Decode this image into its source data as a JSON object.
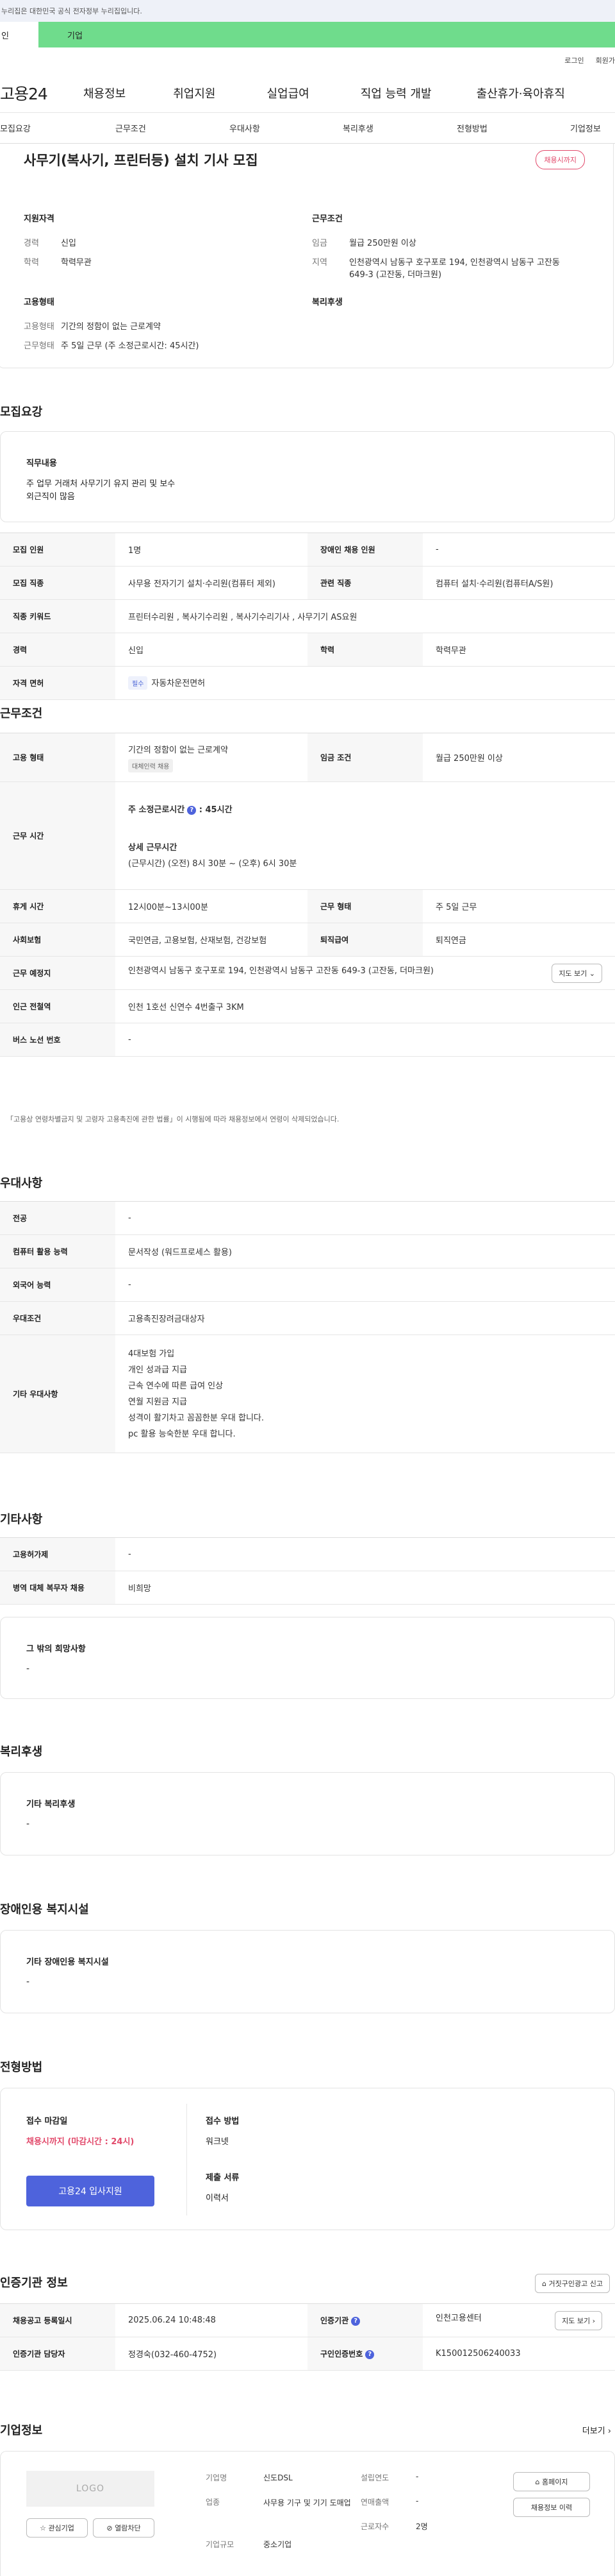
{
  "top_notice": "누리집은 대한민국 공식 전자정부 누리집입니다.",
  "tabs": {
    "left": "인",
    "right": "기업"
  },
  "util": {
    "login": "로그인",
    "join": "회원가"
  },
  "gnb": {
    "logo": "고용24",
    "items": [
      "채용정보",
      "취업지원",
      "실업급여",
      "직업 능력 개발",
      "출산휴가·육아휴직"
    ]
  },
  "subnav": [
    "모집요강",
    "근무조건",
    "우대사항",
    "복리후생",
    "전형방법",
    "기업정보"
  ],
  "title": {
    "text": "사무기(복사기, 프린터등) 설치 기사 모집",
    "status": "채용시까지"
  },
  "summary": {
    "qual_title": "지원자격",
    "cond_title": "근무조건",
    "emp_title": "고용형태",
    "welfare_title": "복리후생",
    "qual": [
      {
        "k": "경력",
        "v": "신입"
      },
      {
        "k": "학력",
        "v": "학력무관"
      }
    ],
    "cond": [
      {
        "k": "임금",
        "v": "월급 250만원 이상"
      },
      {
        "k": "지역",
        "v": "인천광역시 남동구 호구포로 194, 인천광역시 남동구 고잔동 649-3 (고잔동, 더마크원)"
      }
    ],
    "emp": [
      {
        "k": "고용형태",
        "v": "기간의 정함이 없는 근로계약"
      },
      {
        "k": "근무형태",
        "v": "주 5일 근무 (주 소정근로시간: 45시간)"
      }
    ]
  },
  "recruit": {
    "section_title": "모집요강",
    "duty_title": "직무내용",
    "duty_lines": [
      "주 업무 거래처 사무기기 유지 관리 및 보수",
      "외근직이 많음"
    ],
    "rows": [
      {
        "k1": "모집 인원",
        "v1": "1명",
        "k2": "장애인 채용 인원",
        "v2": "-"
      },
      {
        "k1": "모집 직종",
        "v1": "사무용 전자기기 설치·수리원(컴퓨터 제외)",
        "k2": "관련 직종",
        "v2": "컴퓨터 설치·수리원(컴퓨터A/S원)"
      },
      {
        "k1": "직종 키워드",
        "v1": "프린터수리원 , 복사기수리원 , 복사기수리기사 , 사무기기 AS요원"
      },
      {
        "k1": "경력",
        "v1": "신입",
        "k2": "학력",
        "v2": "학력무관"
      },
      {
        "k1": "자격 면허",
        "badge": "필수",
        "v1": "자동차운전면허"
      }
    ]
  },
  "work": {
    "section_title": "근무조건",
    "emp_k": "고용 형태",
    "emp_v": "기간의 정함이 없는 근로계약",
    "emp_badge": "대체인력 채용",
    "wage_k": "임금 조건",
    "wage_v": "월급 250만원 이상",
    "time_k": "근무 시간",
    "time_main": "주 소정근로시간",
    "time_hours": "45시간",
    "time_detail_title": "상세 근무시간",
    "time_detail": "(근무시간) (오전) 8시 30분 ~ (오후) 6시 30분",
    "rows": [
      {
        "k1": "휴게 시간",
        "v1": "12시00분~13시00분",
        "k2": "근무 형태",
        "v2": "주 5일 근무"
      },
      {
        "k1": "사회보험",
        "v1": "국민연금, 고용보험, 산재보험, 건강보험",
        "k2": "퇴직급여",
        "v2": "퇴직연금"
      }
    ],
    "loc_k": "근무 예정지",
    "loc_v": "인천광역시 남동구 호구포로 194, 인천광역시 남동구 고잔동 649-3 (고잔동, 더마크원)",
    "map_btn": "지도 보기 ⌄",
    "subway_k": "인근 전철역",
    "subway_v": "인천 1호선 신연수 4번출구 3KM",
    "bus_k": "버스 노선 번호",
    "bus_v": "-",
    "note": "「고용상 연령차별금지 및 고령자 고용촉진에 관한 법률」이 시행됨에 따라 채용정보에서 연령이 삭제되었습니다."
  },
  "pref": {
    "section_title": "우대사항",
    "rows": [
      {
        "k": "전공",
        "v": "-"
      },
      {
        "k": "컴퓨터 활용 능력",
        "v": "문서작성 (워드프로세스 활용)"
      },
      {
        "k": "외국어 능력",
        "v": "-"
      },
      {
        "k": "우대조건",
        "v": "고용촉진장려금대상자"
      }
    ],
    "etc_k": "기타 우대사항",
    "etc_lines": [
      "4대보험 가입",
      "개인 성과급 지급",
      "근속 연수에 따른 급여 인상",
      "연월 지원금 지급",
      "성격이 활기차고 꼼꼼한분 우대 합니다.",
      "pc 활용 능숙한분 우대 합니다."
    ]
  },
  "other": {
    "section_title": "기타사항",
    "rows": [
      {
        "k": "고용허가제",
        "v": "-"
      },
      {
        "k": "병역 대체 복무자 채용",
        "v": "비희망"
      }
    ],
    "hope_title": "그 밖의 희망사항",
    "hope_v": "-"
  },
  "welfare": {
    "section_title": "복리후생",
    "box_title": "기타 복리후생",
    "box_v": "-"
  },
  "disabled": {
    "section_title": "장애인용 복지시설",
    "box_title": "기타 장애인용 복지시설",
    "box_v": "-"
  },
  "apply": {
    "section_title": "전형방법",
    "deadline_k": "접수 마감일",
    "deadline_v": "채용시까지 (마감시간 : 24시)",
    "method_k": "접수 방법",
    "method_v": "워크넷",
    "docs_k": "제출 서류",
    "docs_v": "이력서",
    "apply_btn": "고용24 입사지원"
  },
  "cert": {
    "section_title": "인증기관 정보",
    "report_btn": "거짓구인광고 신고",
    "rows": [
      {
        "k1": "채용공고 등록일시",
        "v1": "2025.06.24 10:48:48",
        "k2": "인증기관",
        "v2": "인천고용센터",
        "btn": "지도 보기 ›"
      },
      {
        "k1": "인증기관 담당자",
        "v1": "정경숙(032-460-4752)",
        "k2": "구인인증번호",
        "v2": "K150012506240033"
      }
    ]
  },
  "company": {
    "section_title": "기업정보",
    "more": "더보기 ›",
    "logo": "LOGO",
    "interest_btn": "관심기업",
    "block_btn": "열람차단",
    "fields": [
      {
        "k": "기업명",
        "v": "신도DSL"
      },
      {
        "k": "업종",
        "v": "사무용 기구 및 기기 도매업"
      },
      {
        "k": "기업규모",
        "v": "중소기업"
      },
      {
        "k": "설립연도",
        "v": "-"
      },
      {
        "k": "연매출액",
        "v": "-"
      },
      {
        "k": "근로자수",
        "v": "2명"
      }
    ],
    "homepage_btn": "홈페이지",
    "jobs_btn": "채용정보 이력"
  }
}
